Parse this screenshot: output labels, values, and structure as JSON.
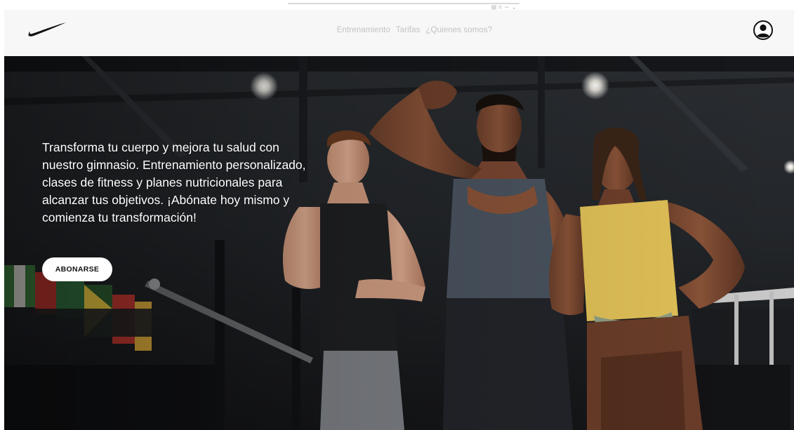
{
  "brand": {
    "logo_icon": "swoosh-logo-icon",
    "logo_color": "#111111"
  },
  "nav": {
    "items": [
      {
        "label": "Entrenamiento"
      },
      {
        "label": "Tarifas"
      },
      {
        "label": "¿Quienes somos?"
      }
    ],
    "text_color": "#c2c2c4"
  },
  "header": {
    "background": "#f7f7f8",
    "account_icon": "user-circle-icon"
  },
  "hero": {
    "copy": "Transforma tu cuerpo y mejora tu salud con nuestro gimnasio. Entrenamiento personalizado, clases de fitness y planes nutricionales para alcanzar tus objetivos. ¡Abónate hoy mismo y comienza tu transformación!",
    "cta_label": "ABONARSE",
    "image": "gym-photo-three-athletes"
  }
}
